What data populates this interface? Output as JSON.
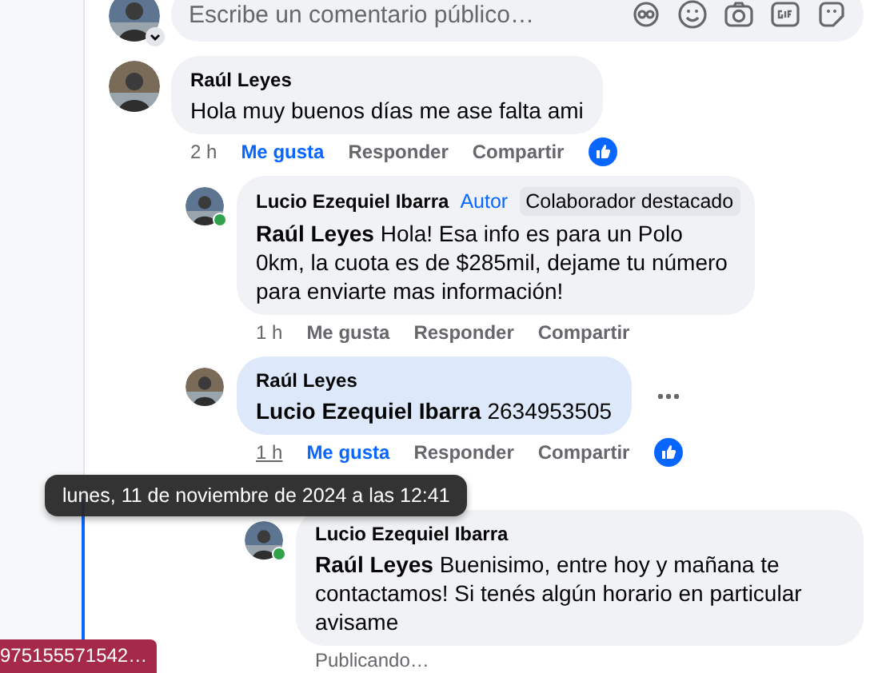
{
  "composer": {
    "placeholder": "Escribe un comentario público…"
  },
  "comments": [
    {
      "author": "Raúl Leyes",
      "online": false,
      "text": "Hola muy buenos días me ase falta ami",
      "highlighted": false,
      "more": false,
      "time": "2 h",
      "time_hovered": false,
      "like": "Me gusta",
      "liked": true,
      "reply": "Responder",
      "share": "Compartir",
      "reaction": true,
      "children": [
        {
          "author": "Lucio Ezequiel Ibarra",
          "online": true,
          "badges": [
            {
              "kind": "author",
              "label": "Autor"
            },
            {
              "kind": "top-fan",
              "label": "Colaborador destacado"
            }
          ],
          "text": "**Raúl Leyes** Hola! Esa info es para un Polo 0km, la cuota es de $285mil, dejame tu número para enviarte mas información!",
          "highlighted": false,
          "more": false,
          "time": "1 h",
          "time_hovered": false,
          "like": "Me gusta",
          "liked": false,
          "reply": "Responder",
          "share": "Compartir",
          "reaction": false
        },
        {
          "author": "Raúl Leyes",
          "online": false,
          "text": "**Lucio Ezequiel Ibarra** 2634953505",
          "highlighted": true,
          "more": true,
          "time": "1 h",
          "time_hovered": true,
          "like": "Me gusta",
          "liked": true,
          "reply": "Responder",
          "share": "Compartir",
          "reaction": true,
          "children": [
            {
              "author": "Lucio Ezequiel Ibarra",
              "online": true,
              "text": "**Raúl Leyes** Buenisimo, entre hoy y mañana te contactamos! Si tenés algún horario en particular avisame",
              "highlighted": false,
              "more": false,
              "status": "Publicando…"
            }
          ]
        }
      ]
    }
  ],
  "tooltip": {
    "text": "lunes, 11 de noviembre de 2024 a las 12:41"
  },
  "corner_tag": {
    "text": "975155571542…"
  }
}
